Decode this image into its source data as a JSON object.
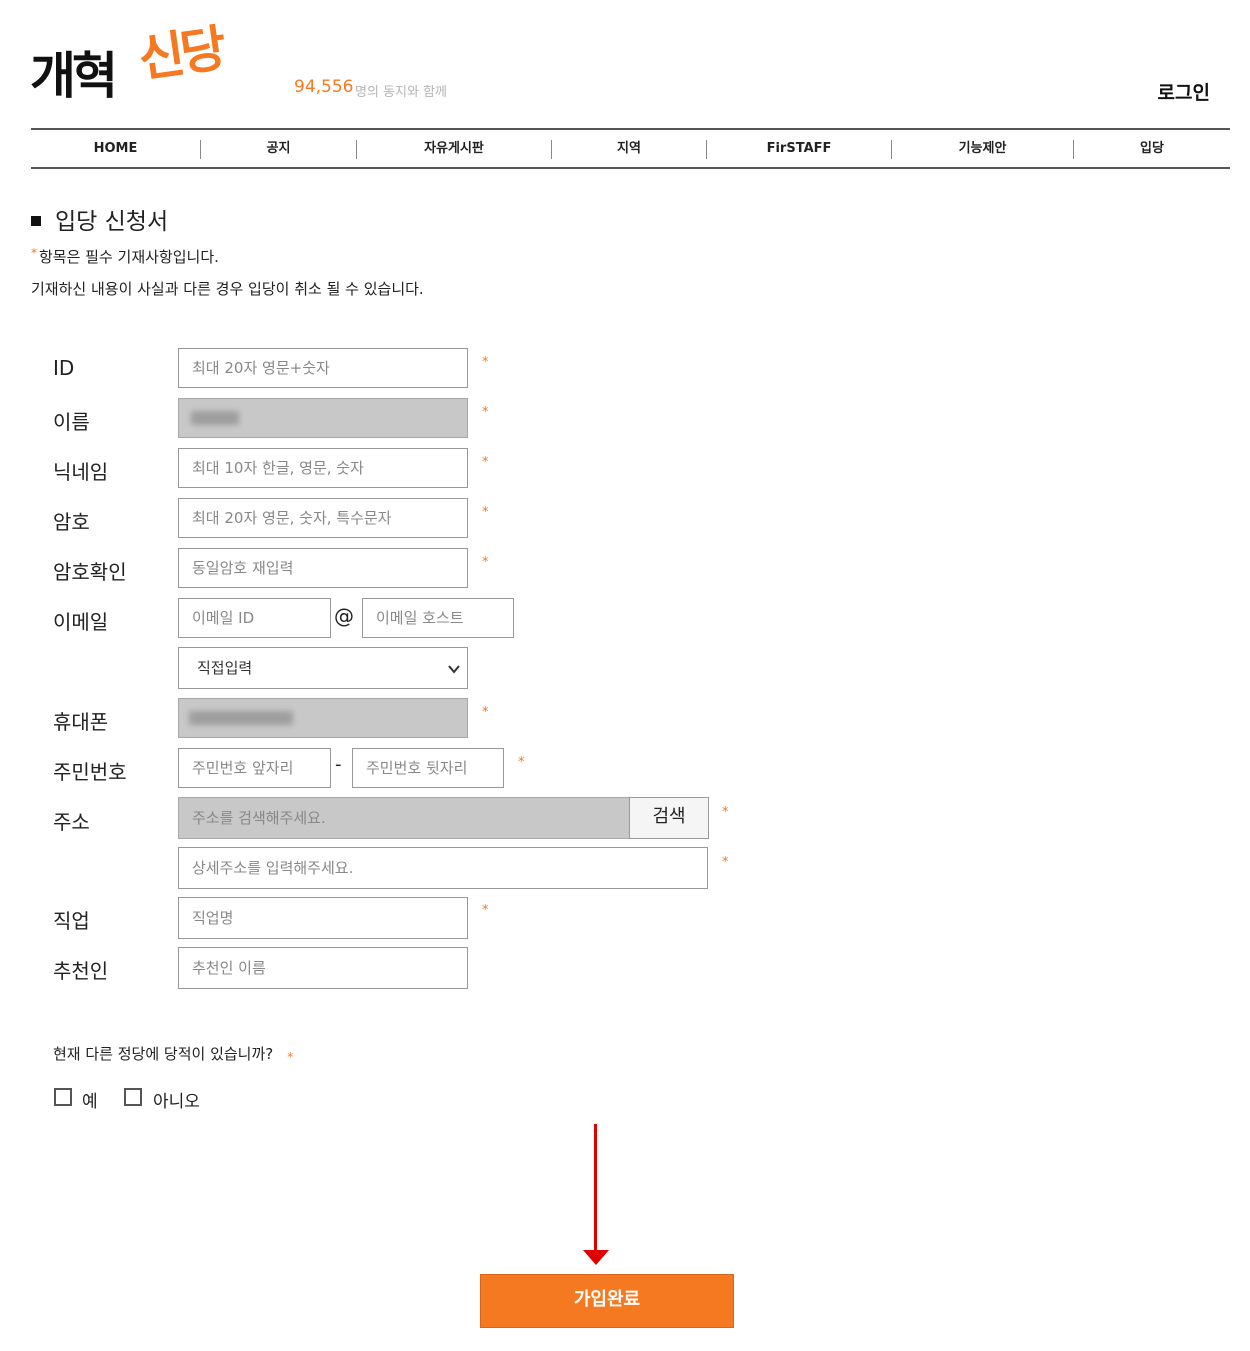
{
  "header": {
    "logo_black": "개혁",
    "logo_orange": "신당",
    "member_count": "94,556",
    "member_suffix": "명의 동지와 함께",
    "login": "로그인"
  },
  "nav": {
    "items": [
      "HOME",
      "공지",
      "자유게시판",
      "지역",
      "FirSTAFF",
      "기능제안",
      "입당"
    ]
  },
  "page": {
    "title": "입당 신청서",
    "required_star": "*",
    "notice_required": "항목은 필수 기재사항입니다.",
    "notice_cancel": "기재하신 내용이 사실과 다른 경우 입당이 취소 될 수 있습니다."
  },
  "form": {
    "id": {
      "label": "ID",
      "placeholder": "최대 20자 영문+숫자"
    },
    "name": {
      "label": "이름"
    },
    "nickname": {
      "label": "닉네임",
      "placeholder": "최대 10자 한글, 영문, 숫자"
    },
    "password": {
      "label": "암호",
      "placeholder": "최대 20자 영문, 숫자, 특수문자"
    },
    "password_confirm": {
      "label": "암호확인",
      "placeholder": "동일암호 재입력"
    },
    "email": {
      "label": "이메일",
      "id_placeholder": "이메일 ID",
      "at": "@",
      "host_placeholder": "이메일 호스트",
      "select_value": "직접입력"
    },
    "phone": {
      "label": "휴대폰"
    },
    "resident": {
      "label": "주민번호",
      "front_placeholder": "주민번호 앞자리",
      "dash": "-",
      "back_placeholder": "주민번호 뒷자리"
    },
    "address": {
      "label": "주소",
      "search_placeholder": "주소를 검색해주세요.",
      "search_button": "검색",
      "detail_placeholder": "상세주소를 입력해주세요."
    },
    "job": {
      "label": "직업",
      "placeholder": "직업명"
    },
    "referrer": {
      "label": "추천인",
      "placeholder": "추천인 이름"
    },
    "party_question": "현재 다른 정당에 당적이 있습니까?",
    "option_yes": "예",
    "option_no": "아니오",
    "submit": "가입완료"
  },
  "colors": {
    "accent": "#f57921",
    "arrow": "#e00000",
    "disabled_input": "#c8c8c8"
  }
}
